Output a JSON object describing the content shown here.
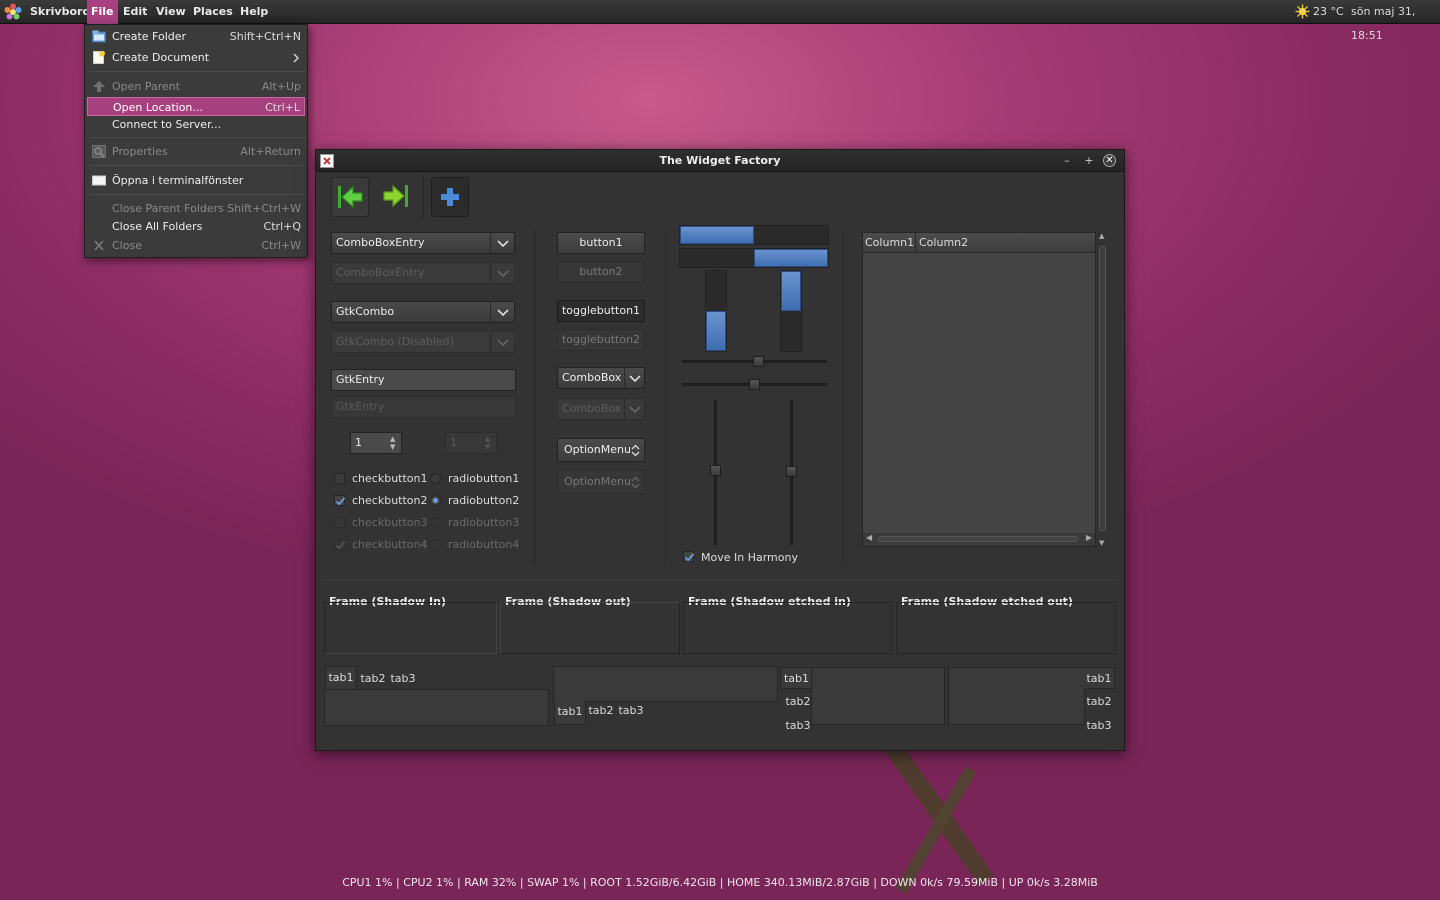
{
  "panel": {
    "app_name": "Skrivbord",
    "menus": [
      "File",
      "Edit",
      "View",
      "Places",
      "Help"
    ],
    "weather": "23 °C",
    "clock": "sön maj 31, 18:51"
  },
  "file_menu": {
    "items": [
      {
        "label": "Create Folder",
        "accel": "Shift+Ctrl+N",
        "icon": "folder-icon"
      },
      {
        "label": "Create Document",
        "accel": "",
        "icon": "document-icon"
      },
      {
        "label": "Open Parent",
        "accel": "Alt+Up",
        "icon": "up-arrow-icon"
      },
      {
        "label": "Open Location...",
        "accel": "Ctrl+L",
        "icon": ""
      },
      {
        "label": "Connect to Server...",
        "accel": "",
        "icon": ""
      },
      {
        "label": "Properties",
        "accel": "Alt+Return",
        "icon": "properties-icon"
      },
      {
        "label": "Öppna i terminalfönster",
        "accel": "",
        "icon": "terminal-icon"
      },
      {
        "label": "Close Parent Folders",
        "accel": "Shift+Ctrl+W",
        "icon": ""
      },
      {
        "label": "Close All Folders",
        "accel": "Ctrl+Q",
        "icon": ""
      },
      {
        "label": "Close",
        "accel": "Ctrl+W",
        "icon": "close-icon"
      }
    ]
  },
  "window": {
    "title": "The Widget Factory",
    "col1": {
      "combobox_entry": "ComboBoxEntry",
      "combobox_entry_disabled": "ComboBoxEntry",
      "gtkcombo": "GtkCombo",
      "gtkcombo_disabled": "GtkCombo (Disabled)",
      "gtkentry": "GtkEntry",
      "gtkentry_disabled": "GtkEntry",
      "spin1": "1",
      "spin2": "1",
      "checks": [
        "checkbutton1",
        "checkbutton2",
        "checkbutton3",
        "checkbutton4"
      ],
      "radios": [
        "radiobutton1",
        "radiobutton2",
        "radiobutton3",
        "radiobutton4"
      ]
    },
    "col2": {
      "button1": "button1",
      "button2": "button2",
      "toggle1": "togglebutton1",
      "toggle2": "togglebutton2",
      "combobox": "ComboBox",
      "combobox_disabled": "ComboBox",
      "optionmenu": "OptionMenu",
      "optionmenu_disabled": "OptionMenu"
    },
    "col3": {
      "move_in_harmony": "Move In Harmony",
      "progress_h1": 0.5,
      "progress_h2": 0.5,
      "progress_v1": 0.5,
      "progress_v2": 0.5
    },
    "tree": {
      "columns": [
        "Column1",
        "Column2"
      ]
    },
    "frames": [
      "Frame (Shadow In)",
      "Frame (Shadow out)",
      "Frame (Shadow etched in)",
      "Frame (Shadow etched out)"
    ],
    "tabs": [
      "tab1",
      "tab2",
      "tab3"
    ]
  },
  "statusline": "CPU1 1% | CPU2 1% | RAM 32% | SWAP 1% | ROOT 1.52GiB/6.42GiB | HOME 340.13MiB/2.87GiB | DOWN 0k/s 79.59MiB | UP 0k/s 3.28MiB",
  "colors": {
    "accent": "#a6407e",
    "desktop": "#a53b74",
    "progress": "#4e7dc0"
  }
}
